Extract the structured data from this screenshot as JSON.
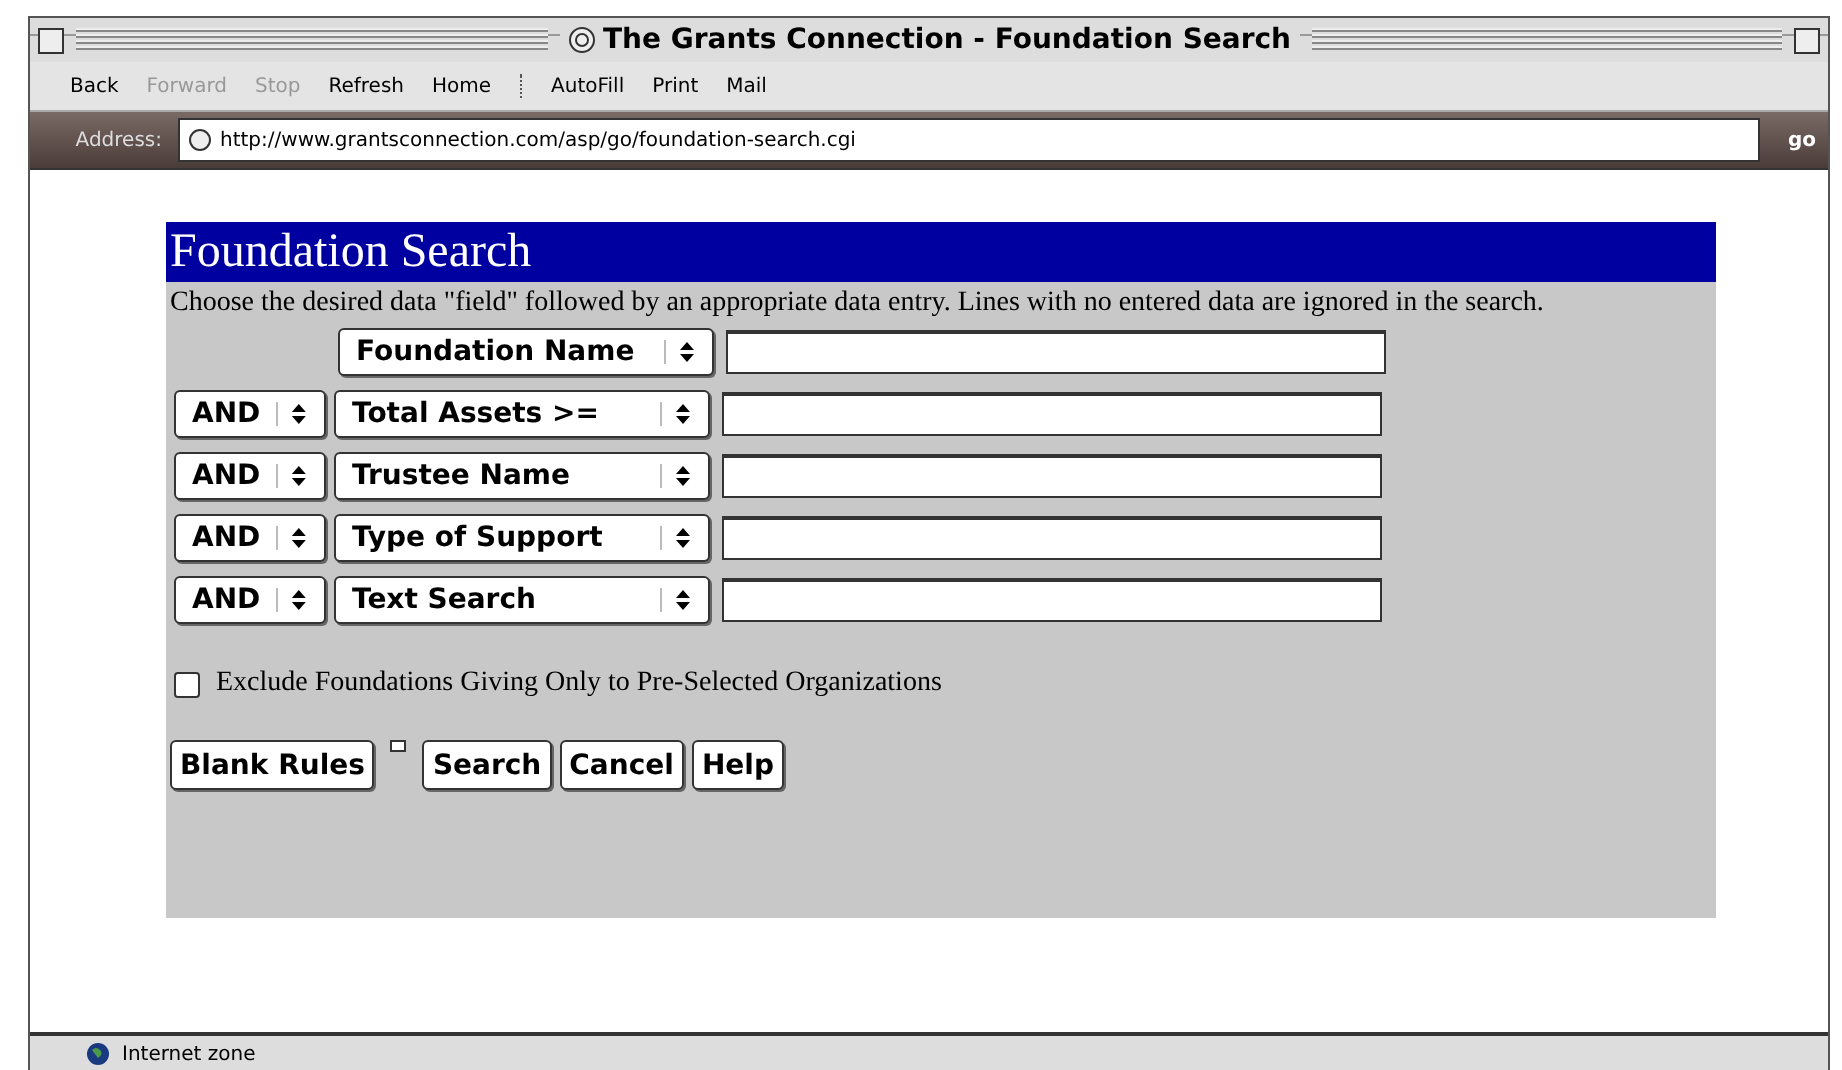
{
  "window": {
    "title": "The Grants Connection - Foundation Search"
  },
  "toolbar": [
    {
      "label": "Back",
      "disabled": false
    },
    {
      "label": "Forward",
      "disabled": true
    },
    {
      "label": "Stop",
      "disabled": true
    },
    {
      "label": "Refresh",
      "disabled": false
    },
    {
      "label": "Home",
      "disabled": false
    },
    {
      "label": "AutoFill",
      "disabled": false
    },
    {
      "label": "Print",
      "disabled": false
    },
    {
      "label": "Mail",
      "disabled": false
    }
  ],
  "address_bar": {
    "label": "Address:",
    "url": "http://www.grantsconnection.com/asp/go/foundation-search.cgi",
    "go": "go"
  },
  "form": {
    "heading": "Foundation Search",
    "instructions": "Choose the desired data \"field\" followed by an appropriate data entry. Lines with no entered data are ignored in the search.",
    "rules": [
      {
        "field": "Foundation Name"
      },
      {
        "connector": "AND",
        "field": "Total Assets >="
      },
      {
        "connector": "AND",
        "field": "Trustee Name"
      },
      {
        "connector": "AND",
        "field": "Type of Support"
      },
      {
        "connector": "AND",
        "field": "Text Search"
      }
    ],
    "exclude_checkbox": {
      "label": "Exclude Foundations Giving Only to Pre-Selected Organizations",
      "checked": false
    },
    "buttons": [
      "Blank Rules",
      "Search",
      "Cancel",
      "Help"
    ]
  },
  "status_bar": {
    "zone": "Internet zone"
  }
}
